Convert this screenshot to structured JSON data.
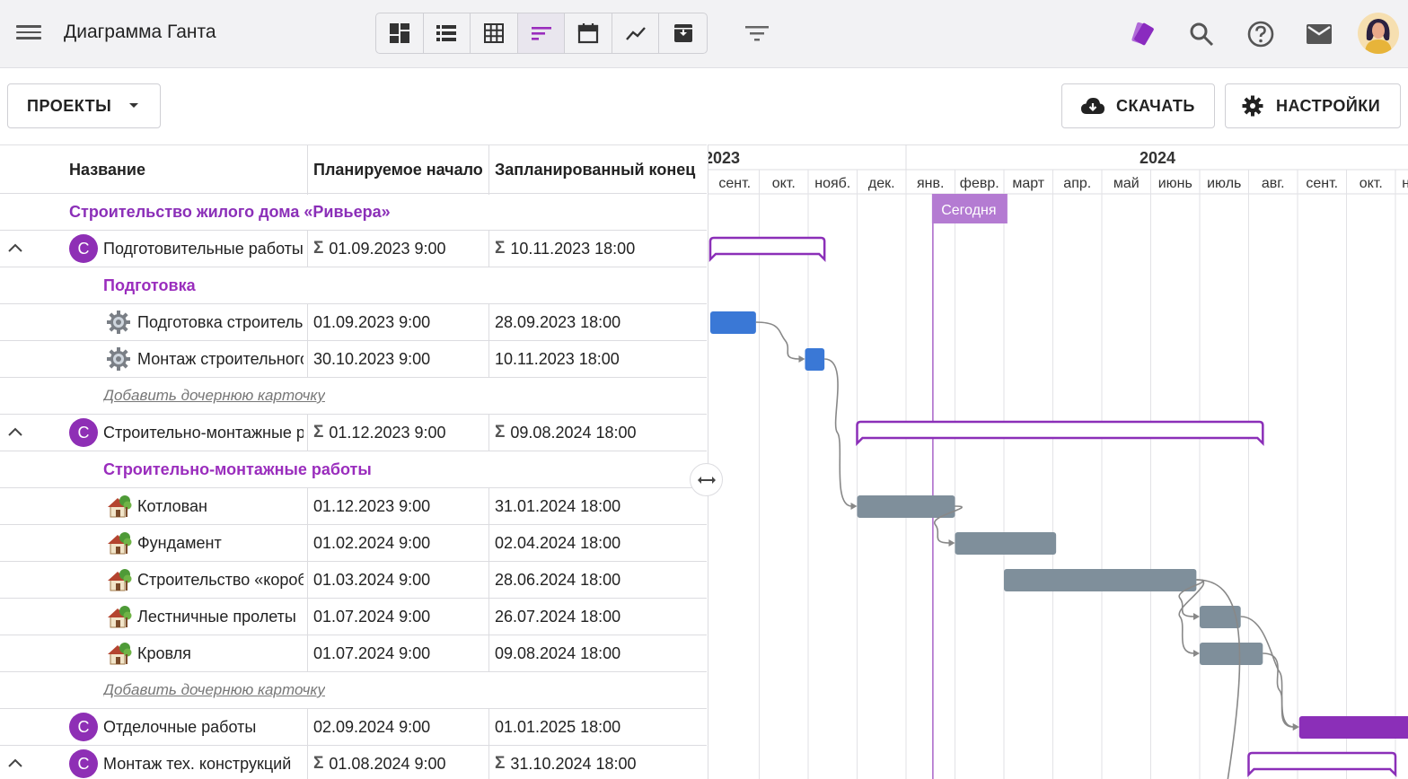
{
  "header": {
    "title": "Диаграмма Ганта",
    "views": [
      {
        "icon": "board-view-icon",
        "active": false
      },
      {
        "icon": "list-view-icon",
        "active": false
      },
      {
        "icon": "table-view-icon",
        "active": false
      },
      {
        "icon": "gantt-view-icon",
        "active": true
      },
      {
        "icon": "calendar-view-icon",
        "active": false
      },
      {
        "icon": "chart-view-icon",
        "active": false
      },
      {
        "icon": "archive-view-icon",
        "active": false
      }
    ],
    "accent_color": "#9a2dbd"
  },
  "toolbar": {
    "projects_label": "ПРОЕКТЫ",
    "download_label": "СКАЧАТЬ",
    "settings_label": "НАСТРОЙКИ"
  },
  "grid": {
    "columns": [
      "Название",
      "Планируемое начало",
      "Запланированный конец"
    ],
    "rows": [
      {
        "type": "project",
        "name": "Строительство жилого дома «Ривьера»"
      },
      {
        "type": "card",
        "badge": "С",
        "collapsible": true,
        "name": "Подготовительные работы",
        "start": "01.09.2023 9:00",
        "end": "10.11.2023 18:00",
        "sigma": true
      },
      {
        "type": "group",
        "name": "Подготовка"
      },
      {
        "type": "task",
        "icon": "gear",
        "name": "Подготовка строительной площадки",
        "start": "01.09.2023 9:00",
        "end": "28.09.2023 18:00"
      },
      {
        "type": "task",
        "icon": "gear",
        "name": "Монтаж строительного городка",
        "start": "30.10.2023 9:00",
        "end": "10.11.2023 18:00"
      },
      {
        "type": "add",
        "name": "Добавить дочернюю карточку"
      },
      {
        "type": "card",
        "badge": "С",
        "collapsible": true,
        "name": "Строительно-монтажные работы",
        "start": "01.12.2023 9:00",
        "end": "09.08.2024 18:00",
        "sigma": true
      },
      {
        "type": "group",
        "name": "Строительно-монтажные работы"
      },
      {
        "type": "task",
        "icon": "house",
        "name": "Котлован",
        "start": "01.12.2023 9:00",
        "end": "31.01.2024 18:00"
      },
      {
        "type": "task",
        "icon": "house",
        "name": "Фундамент",
        "start": "01.02.2024 9:00",
        "end": "02.04.2024 18:00"
      },
      {
        "type": "task",
        "icon": "house",
        "name": "Строительство «коробки»",
        "start": "01.03.2024 9:00",
        "end": "28.06.2024 18:00"
      },
      {
        "type": "task",
        "icon": "house",
        "name": "Лестничные пролеты",
        "start": "01.07.2024 9:00",
        "end": "26.07.2024 18:00"
      },
      {
        "type": "task",
        "icon": "house",
        "name": "Кровля",
        "start": "01.07.2024 9:00",
        "end": "09.08.2024 18:00"
      },
      {
        "type": "add",
        "name": "Добавить дочернюю карточку"
      },
      {
        "type": "card",
        "badge": "С",
        "collapsible": false,
        "name": "Отделочные работы",
        "start": "02.09.2024 9:00",
        "end": "01.01.2025 18:00",
        "sigma": false
      },
      {
        "type": "card",
        "badge": "С",
        "collapsible": true,
        "name": "Монтаж тех. конструкций",
        "start": "01.08.2024 9:00",
        "end": "31.10.2024 18:00",
        "sigma": true
      }
    ]
  },
  "gantt": {
    "years": [
      {
        "label": "2023",
        "first_month": 0
      },
      {
        "label": "2024",
        "first_month": 4
      }
    ],
    "months": [
      "сент.",
      "окт.",
      "нояб.",
      "дек.",
      "янв.",
      "февр.",
      "март",
      "апр.",
      "май",
      "июнь",
      "июль",
      "авг.",
      "сент.",
      "окт.",
      "нояб."
    ],
    "timeline_start": "2023-09-01",
    "today_label": "Сегодня",
    "today": "2024-01-18",
    "summary_color": "#8b2fb8",
    "task_color_blue": "#3a78d6",
    "task_color_grey": "#7f8f9b",
    "task_color_purple": "#8b2fb8"
  }
}
